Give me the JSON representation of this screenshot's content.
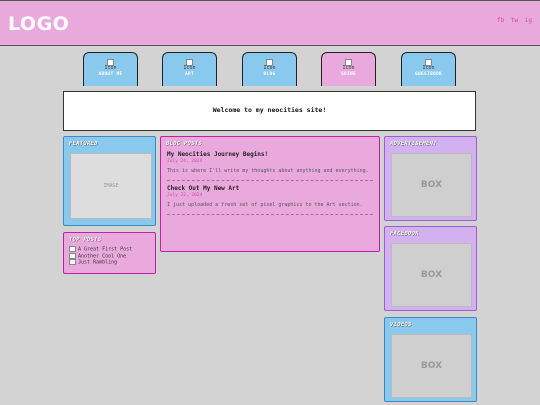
{
  "header": {
    "logo": "LOGO",
    "social": [
      "fb",
      "tw",
      "ig"
    ]
  },
  "nav": [
    {
      "icon_alt": "Icon",
      "label": "ABOUT ME"
    },
    {
      "icon_alt": "Icon",
      "label": "ART"
    },
    {
      "icon_alt": "Icon",
      "label": "BLOG"
    },
    {
      "icon_alt": "Icon",
      "label": "SHINE"
    },
    {
      "icon_alt": "Icon",
      "label": "GUESTBOOK"
    }
  ],
  "welcome": "Welcome to my neocities site!",
  "featured": {
    "title": "FEATURED",
    "image_label": "IMAGE"
  },
  "top_posts": {
    "title": "TOP POSTS",
    "items": [
      "A Great First Post",
      "Another Cool One",
      "Just Rambling"
    ]
  },
  "blog": {
    "title": "BLOG POSTS",
    "posts": [
      {
        "title": "My Neocities Journey Begins!",
        "date": "July 24, 2024",
        "body": "This is where I'll write my thoughts about anything and everything."
      },
      {
        "title": "Check Out My New Art",
        "date": "July 22, 2024",
        "body": "I just uploaded a fresh set of pixel graphics to the Art section."
      }
    ]
  },
  "advertisement": {
    "title": "ADVERTISEMENT",
    "box": "BOX"
  },
  "facebook": {
    "title": "FACEBOOK",
    "box": "BOX"
  },
  "videos": {
    "title": "VIDEOS",
    "box": "BOX"
  },
  "colors": {
    "pink": "#eaa9dc",
    "blue": "#89c9ee",
    "purple": "#d3b1f0",
    "background": "#d3d3d3"
  }
}
